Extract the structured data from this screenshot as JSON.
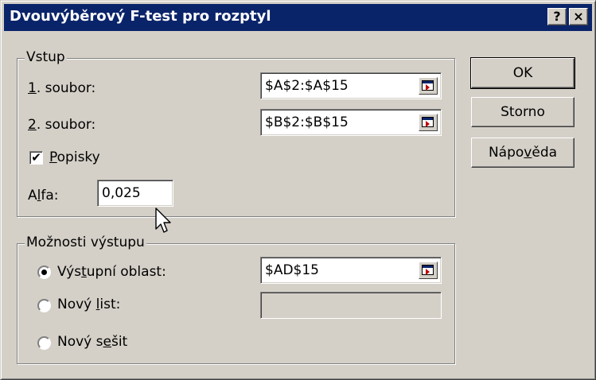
{
  "window": {
    "title": "Dvouvýběrový F-test pro rozptyl",
    "help_glyph": "?",
    "close_glyph": "×"
  },
  "input_group": {
    "legend": "Vstup",
    "range1": {
      "label_u": "1",
      "label_rest": ". soubor:",
      "value": "$A$2:$A$15"
    },
    "range2": {
      "label_u": "2",
      "label_rest": ". soubor:",
      "value": "$B$2:$B$15"
    },
    "labels_checkbox": {
      "check_glyph": "✔",
      "label_u": "P",
      "label_rest": "opisky",
      "checked": true
    },
    "alpha": {
      "label_pre": "A",
      "label_u": "l",
      "label_rest": "fa:",
      "value": "0,025"
    }
  },
  "output_group": {
    "legend": "Možnosti výstupu",
    "output_range": {
      "label_pre": "Výs",
      "label_u": "t",
      "label_rest": "upní oblast:",
      "value": "$AD$15",
      "selected": true
    },
    "new_sheet": {
      "label_pre": "Nový ",
      "label_u": "l",
      "label_rest": "ist:",
      "value": ""
    },
    "new_workbook": {
      "label_pre": "Nový s",
      "label_u": "e",
      "label_rest": "šit"
    }
  },
  "buttons": {
    "ok": "OK",
    "cancel": "Storno",
    "help_pre": "Nápo",
    "help_u": "v",
    "help_rest": "ěda"
  },
  "colors": {
    "title_bar": "#0a246a",
    "face": "#d4d0c8"
  }
}
